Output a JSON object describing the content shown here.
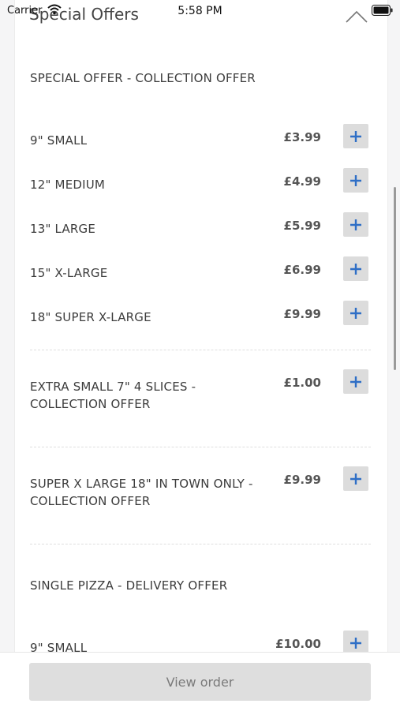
{
  "status_bar": {
    "carrier": "Carrier",
    "time": "5:58 PM"
  },
  "section": {
    "title": "Special Offers"
  },
  "groups": [
    {
      "header": "SPECIAL OFFER - COLLECTION OFFER",
      "items": [
        {
          "name": "9\" SMALL",
          "price": "£3.99"
        },
        {
          "name": "12\" MEDIUM",
          "price": "£4.99"
        },
        {
          "name": "13\" LARGE",
          "price": "£5.99"
        },
        {
          "name": "15\" X-LARGE",
          "price": "£6.99"
        },
        {
          "name": "18\" SUPER X-LARGE",
          "price": "£9.99"
        }
      ]
    },
    {
      "items": [
        {
          "name": "EXTRA SMALL 7\" 4 SLICES - COLLECTION OFFER",
          "price": "£1.00"
        }
      ]
    },
    {
      "items": [
        {
          "name": "SUPER X LARGE 18\" IN TOWN ONLY - COLLECTION OFFER",
          "price": "£9.99"
        }
      ]
    },
    {
      "header": "SINGLE PIZZA - DELIVERY OFFER",
      "items": [
        {
          "name": "9\" SMALL",
          "price": "£10.00"
        }
      ]
    }
  ],
  "footer": {
    "view_order_label": "View order"
  },
  "colors": {
    "accent": "#2f6fc6",
    "button_bg": "#dcdcdc"
  }
}
